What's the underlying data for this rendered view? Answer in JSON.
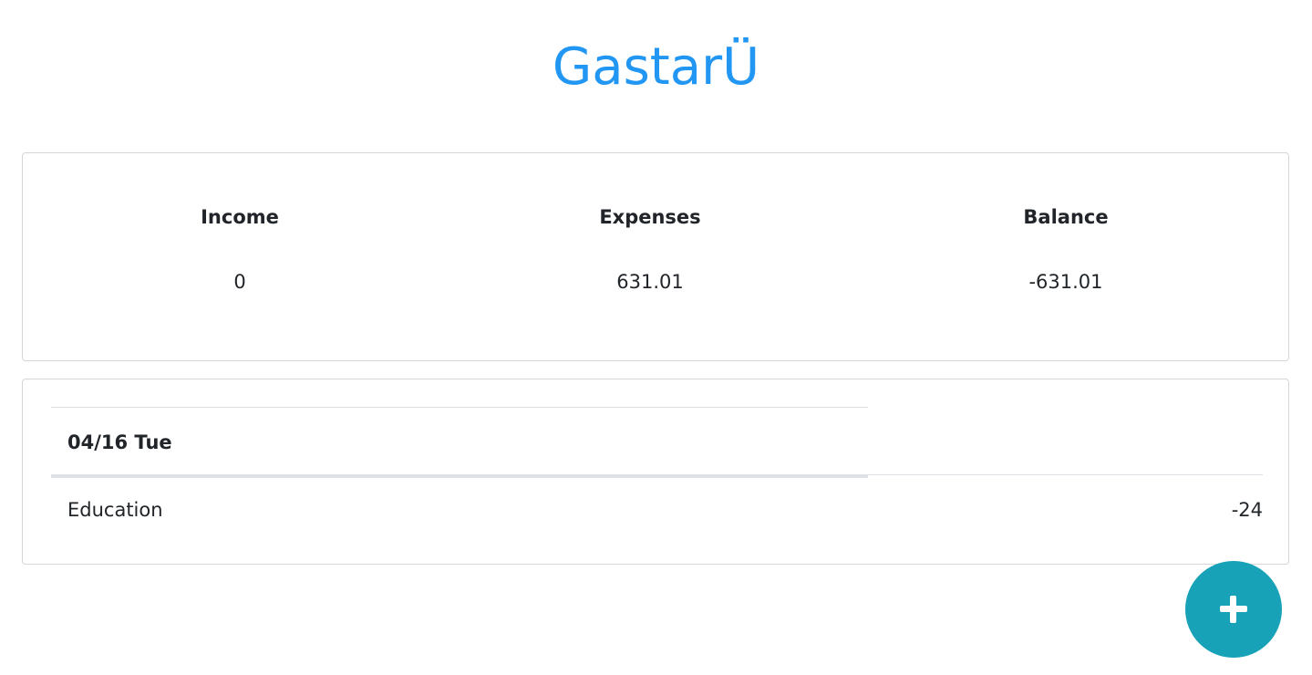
{
  "app": {
    "title": "GastarÜ"
  },
  "summary": {
    "income_label": "Income",
    "income_value": "0",
    "expenses_label": "Expenses",
    "expenses_value": "631.01",
    "balance_label": "Balance",
    "balance_value": "-631.01"
  },
  "transactions": {
    "groups": [
      {
        "date": "04/16 Tue",
        "entries": [
          {
            "category": "Education",
            "amount": "-24"
          }
        ]
      }
    ]
  },
  "fab": {
    "icon": "plus-icon",
    "color": "#17a2b8"
  },
  "colors": {
    "title": "#2196f3",
    "border": "#d6d6d6"
  }
}
